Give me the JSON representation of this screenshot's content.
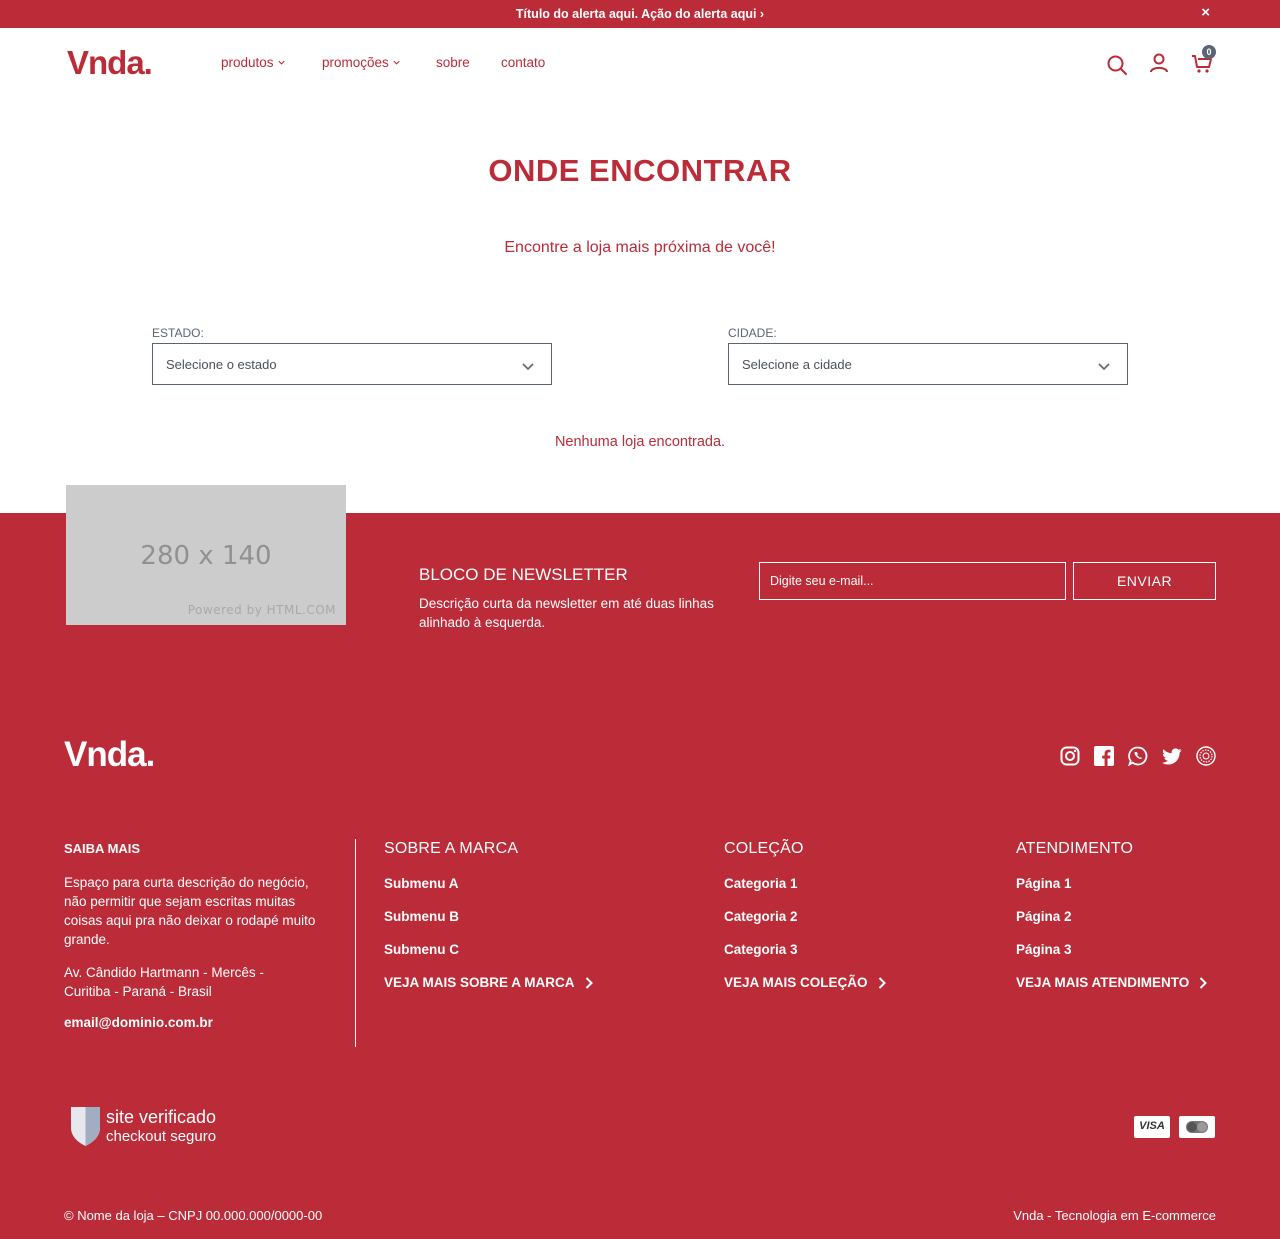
{
  "alert": {
    "text": "Título do alerta aqui. Ação do alerta aqui ›",
    "close": "×"
  },
  "header": {
    "logo": "Vnda.",
    "nav": [
      {
        "label": "produtos"
      },
      {
        "label": "promoções"
      },
      {
        "label": "sobre"
      },
      {
        "label": "contato"
      }
    ],
    "cart_count": "0",
    "icons": [
      "search-icon",
      "user-icon",
      "cart-icon"
    ]
  },
  "main": {
    "title": "ONDE ENCONTRAR",
    "subtitle": "Encontre a loja mais próxima de você!",
    "state": {
      "label": "ESTADO:",
      "value": "Selecione o estado"
    },
    "city": {
      "label": "CIDADE:",
      "value": "Selecione a cidade"
    },
    "empty_message": "Nenhuma loja encontrada."
  },
  "newsletter": {
    "image_text": "280 x 140",
    "image_powered": "Powered by HTML.COM",
    "title": "BLOCO DE NEWSLETTER",
    "description": "Descrição curta da newsletter em até duas linhas alinhado à esquerda.",
    "placeholder": "Digite seu e-mail...",
    "button": "ENVIAR"
  },
  "footer": {
    "logo": "Vnda.",
    "social": [
      "instagram-icon",
      "facebook-icon",
      "whatsapp-icon",
      "twitter-icon",
      "other-social-icon"
    ],
    "about": {
      "title": "SAIBA MAIS",
      "text": "Espaço para curta descrição do negócio, não permitir que sejam escritas muitas coisas aqui pra não deixar o rodapé muito grande.",
      "address": "Av. Cândido Hartmann - Mercês - Curitiba - Paraná - Brasil",
      "email": "email@dominio.com.br"
    },
    "columns": [
      {
        "title": "SOBRE A MARCA",
        "links": [
          "Submenu A",
          "Submenu B",
          "Submenu C"
        ],
        "more": "VEJA MAIS SOBRE A MARCA"
      },
      {
        "title": "COLEÇÃO",
        "links": [
          "Categoria 1",
          "Categoria 2",
          "Categoria 3"
        ],
        "more": "VEJA MAIS COLEÇÃO"
      },
      {
        "title": "ATENDIMENTO",
        "links": [
          "Página 1",
          "Página 2",
          "Página 3"
        ],
        "more": "VEJA MAIS ATENDIMENTO"
      }
    ],
    "verified": {
      "line1": "site verificado",
      "line2": "checkout seguro"
    },
    "payments": {
      "visa": "VISA",
      "master": "mastercard-icon"
    },
    "copyright": "© Nome da loja – CNPJ 00.000.000/0000-00",
    "credit": "Vnda - Tecnologia em E-commerce"
  },
  "colors": {
    "brand": "#bb2b38",
    "accent": "#5b6475",
    "white": "#ffffff"
  }
}
